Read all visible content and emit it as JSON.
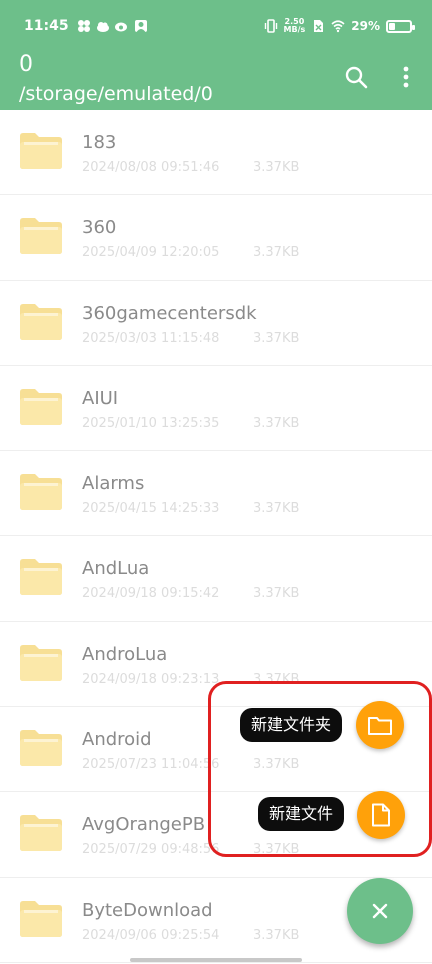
{
  "status_bar": {
    "time": "11:45",
    "net_speed_value": "2.50",
    "net_speed_unit": "MB/s",
    "battery": "29%"
  },
  "header": {
    "count": "0",
    "path": "/storage/emulated/0"
  },
  "files": [
    {
      "name": "183",
      "date": "2024/08/08 09:51:46",
      "size": "3.37KB"
    },
    {
      "name": "360",
      "date": "2025/04/09 12:20:05",
      "size": "3.37KB"
    },
    {
      "name": "360gamecentersdk",
      "date": "2025/03/03 11:15:48",
      "size": "3.37KB"
    },
    {
      "name": "AIUI",
      "date": "2025/01/10 13:25:35",
      "size": "3.37KB"
    },
    {
      "name": "Alarms",
      "date": "2025/04/15 14:25:33",
      "size": "3.37KB"
    },
    {
      "name": "AndLua",
      "date": "2024/09/18 09:15:42",
      "size": "3.37KB"
    },
    {
      "name": "AndroLua",
      "date": "2024/09/18 09:23:13",
      "size": "3.37KB"
    },
    {
      "name": "Android",
      "date": "2025/07/23 11:04:56",
      "size": "3.37KB"
    },
    {
      "name": "AvgOrangePB",
      "date": "2025/07/29 09:48:56",
      "size": "3.37KB"
    },
    {
      "name": "ByteDownload",
      "date": "2024/09/06 09:25:54",
      "size": "3.37KB"
    }
  ],
  "fab_menu": {
    "new_folder_label": "新建文件夹",
    "new_file_label": "新建文件"
  },
  "colors": {
    "primary": "#6dbf8a",
    "accent": "#ffa10a",
    "highlight_border": "#e02020"
  }
}
